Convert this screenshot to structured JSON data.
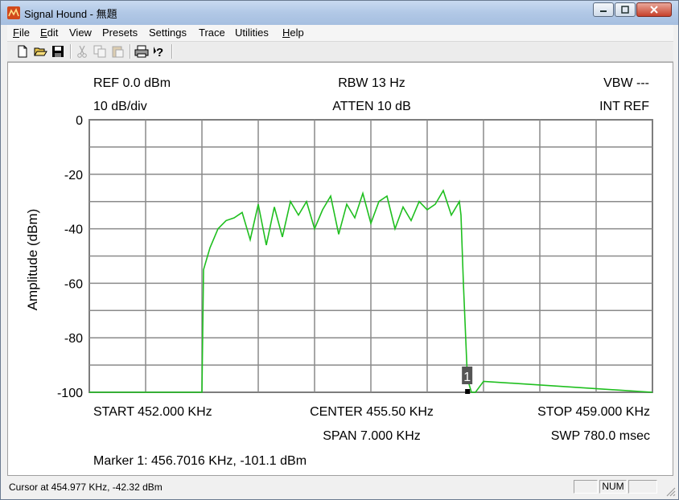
{
  "window": {
    "title": "Signal Hound - 無題"
  },
  "menu": [
    {
      "label": "File",
      "accel": "F",
      "rest": "ile"
    },
    {
      "label": "Edit",
      "accel": "E",
      "rest": "dit"
    },
    {
      "label": "View",
      "accel": "",
      "rest": "View"
    },
    {
      "label": "Presets",
      "accel": "",
      "rest": "Presets"
    },
    {
      "label": "Settings",
      "accel": "",
      "rest": "Settings"
    },
    {
      "label": "Trace",
      "accel": "",
      "rest": "Trace"
    },
    {
      "label": "Utilities",
      "accel": "",
      "rest": "Utilities"
    },
    {
      "label": "Help",
      "accel": "H",
      "rest": "elp"
    }
  ],
  "toolbar": {
    "items": [
      "new-file-icon",
      "open-folder-icon",
      "save-icon",
      "cut-icon",
      "copy-icon",
      "paste-icon",
      "print-icon",
      "help-icon"
    ]
  },
  "display": {
    "ref": "REF 0.0 dBm",
    "rbw": "RBW 13 Hz",
    "vbw": "VBW ---",
    "scale": "10 dB/div",
    "atten": "ATTEN 10 dB",
    "int_ref": "INT REF",
    "start": "START 452.000 KHz",
    "center": "CENTER 455.50 KHz",
    "stop": "STOP 459.000 KHz",
    "span": "SPAN 7.000 KHz",
    "sweep": "SWP 780.0 msec",
    "marker_readout": "Marker 1: 456.7016 KHz, -101.1 dBm",
    "marker_label": "1"
  },
  "chart_data": {
    "type": "line",
    "ylabel": "Amplitude (dBm)",
    "xlabel": "",
    "y_tick_labels": [
      "0",
      "-20",
      "-40",
      "-60",
      "-80",
      "-100"
    ],
    "ylim": [
      -100,
      0
    ],
    "xlim": [
      452.0,
      459.0
    ],
    "x_divisions": 10,
    "y_divisions": 10,
    "grid": true,
    "trace_color": "#1fbf1f",
    "series": [
      {
        "x": [
          452.0,
          453.2,
          453.4,
          453.42,
          453.5,
          453.6,
          453.7,
          453.8,
          453.9,
          454.0,
          454.1,
          454.2,
          454.3,
          454.4,
          454.5,
          454.6,
          454.7,
          454.8,
          454.9,
          455.0,
          455.1,
          455.2,
          455.3,
          455.4,
          455.5,
          455.6,
          455.7,
          455.8,
          455.9,
          456.0,
          456.1,
          456.2,
          456.3,
          456.4,
          456.5,
          456.6,
          456.62,
          456.65,
          456.7,
          456.75,
          456.8,
          456.9,
          459.0
        ],
        "y": [
          -100,
          -100,
          -100,
          -55,
          -47,
          -40,
          -37,
          -36,
          -34,
          -44,
          -31,
          -46,
          -32,
          -43,
          -30,
          -35,
          -30,
          -40,
          -33,
          -28,
          -42,
          -31,
          -36,
          -27,
          -38,
          -30,
          -28,
          -40,
          -32,
          -37,
          -30,
          -33,
          -31,
          -26,
          -35,
          -30,
          -35,
          -60,
          -95,
          -101,
          -100,
          -96,
          -100
        ]
      }
    ],
    "marker": {
      "x": 456.7016,
      "y": -101.1,
      "label": "1"
    }
  },
  "status": {
    "cursor": "Cursor at 454.977 KHz, -42.32 dBm",
    "num": "NUM"
  }
}
